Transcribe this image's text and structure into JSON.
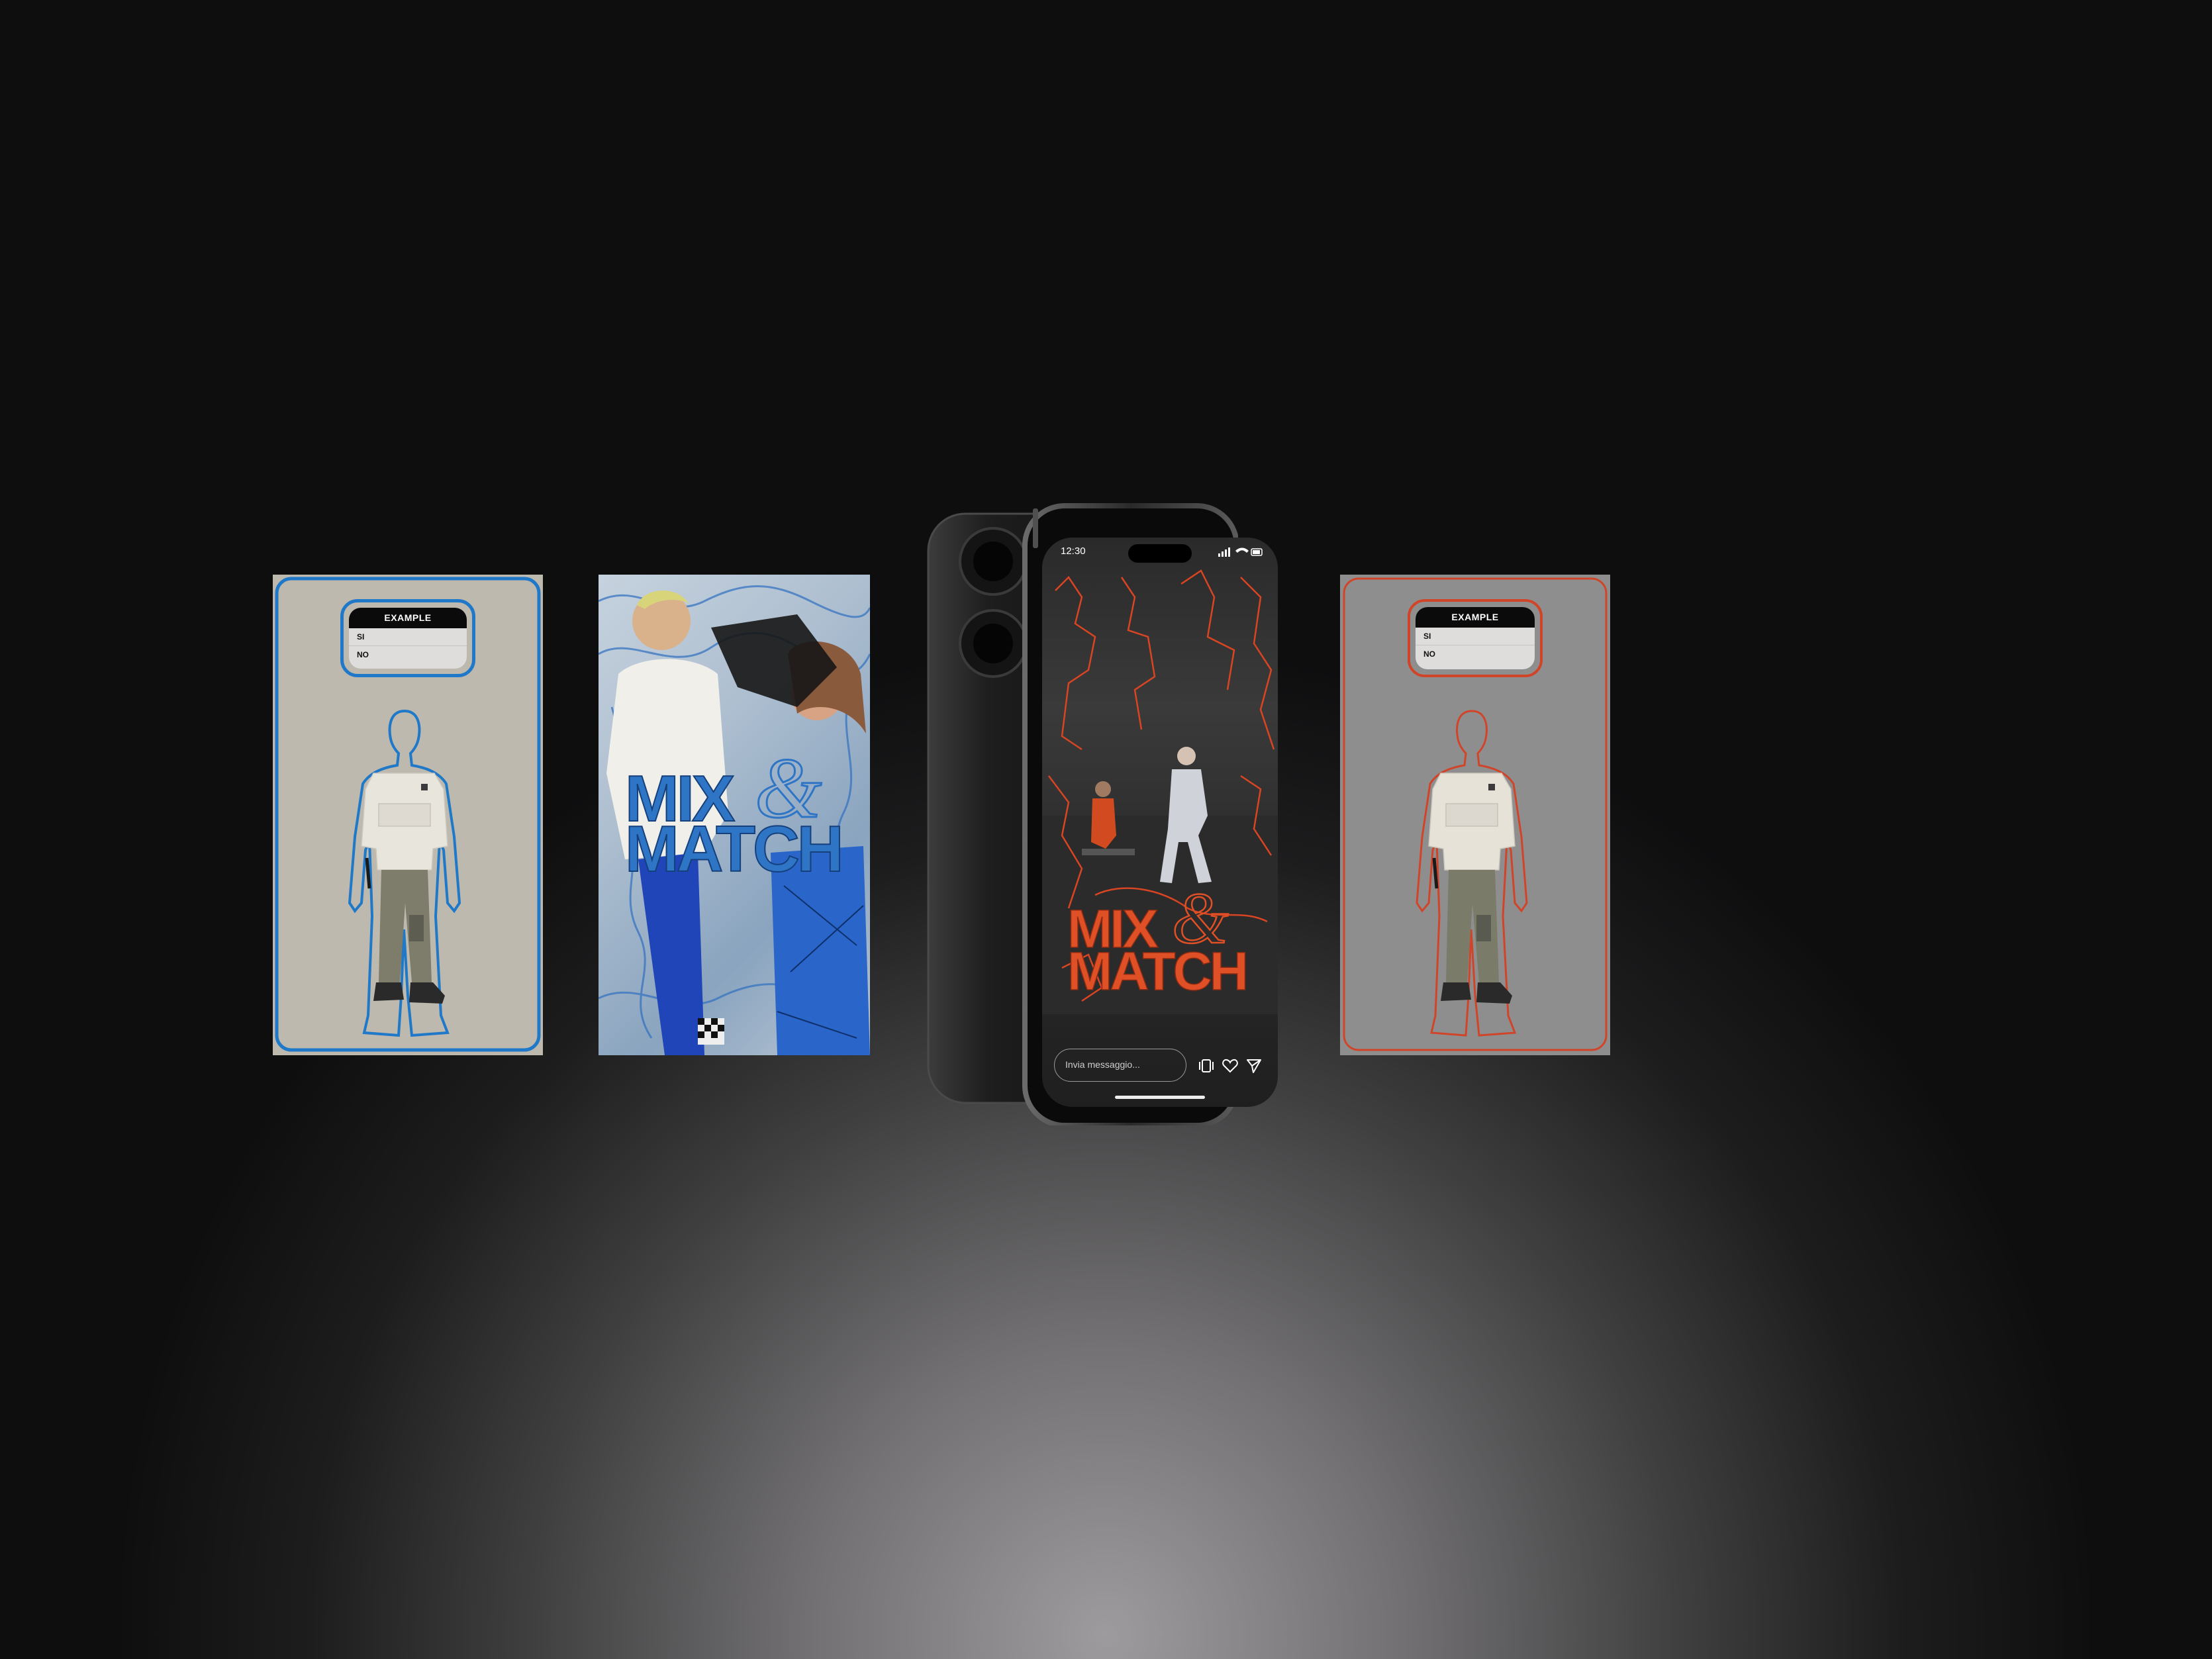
{
  "cards": [
    {
      "poll": {
        "title": "EXAMPLE",
        "options": [
          "SI",
          "NO"
        ]
      },
      "accent": "#1f78c8",
      "background": "#bdb9ae"
    },
    {
      "poll": {
        "title": "EXAMPLE",
        "options": [
          "SI",
          "NO"
        ]
      },
      "accent": "#d0452a",
      "background": "#8f8e8e"
    }
  ],
  "poster": {
    "title_line1": "MIX",
    "title_line2": "MATCH",
    "ampersand": "&",
    "accent": "#2f75c6"
  },
  "phone": {
    "status_time": "12:30",
    "story_title_line1": "MIX",
    "story_title_line2": "MATCH",
    "ampersand": "&",
    "accent": "#d94523",
    "message_placeholder": "Invia messaggio...",
    "icons": [
      "gallery-icon",
      "heart-icon",
      "send-icon"
    ]
  }
}
